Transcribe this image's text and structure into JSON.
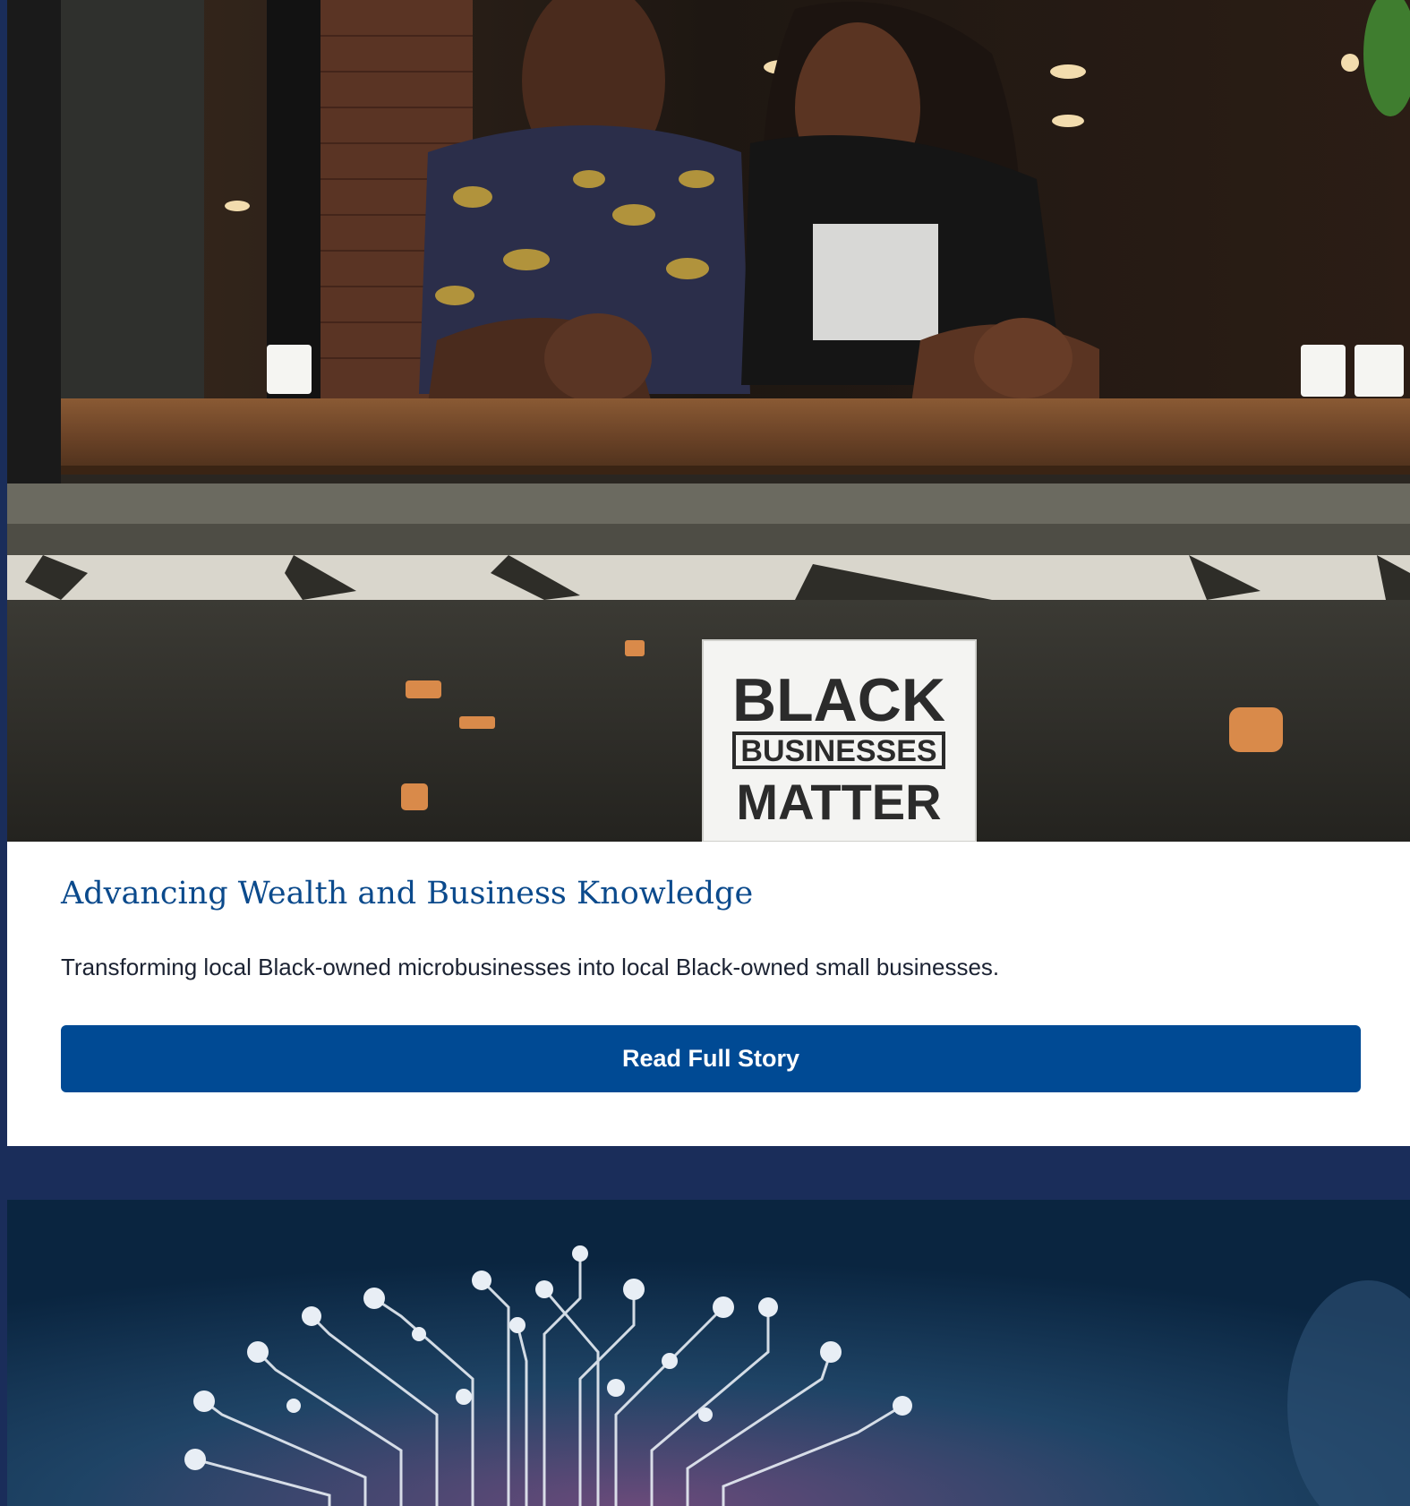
{
  "stories": [
    {
      "image_alt": "Two people smiling and leaning on a café window ledge with a sign reading Black Businesses Matter",
      "sign": {
        "line1": "BLACK",
        "line2": "BUSINESSES",
        "line3": "MATTER"
      },
      "title": "Advancing Wealth and Business Knowledge",
      "description": "Transforming local Black-owned microbusinesses into local Black-owned small businesses.",
      "button_label": "Read Full Story"
    },
    {
      "image_alt": "Circuit-board brain illustration on a dark blue background"
    }
  ],
  "colors": {
    "page_background": "#1a2d5a",
    "title": "#0b4a8c",
    "button": "#004a94",
    "button_text": "#ffffff",
    "body_text": "#1c2333"
  }
}
